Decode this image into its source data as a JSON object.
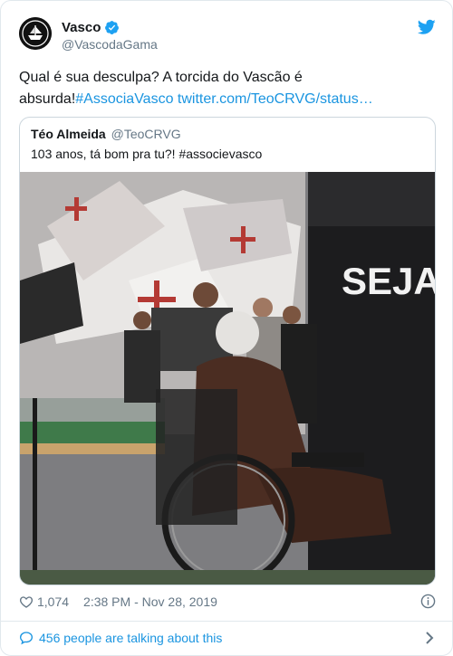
{
  "colors": {
    "link": "#1b95e0",
    "text": "#14171a",
    "secondary": "#657786",
    "border": "#e1e8ed",
    "verified": "#1da1f2"
  },
  "author": {
    "display_name": "Vasco",
    "handle": "@VascodaGama",
    "verified_icon": "verified-badge-icon",
    "avatar_icon": "vasco-crest-logo"
  },
  "brand_icon": "twitter-bird-icon",
  "tweet": {
    "text_part1": "Qual é sua desculpa? A torcida do Vascão é absurda!",
    "hashtag": "#AssociaVasco",
    "link_text": "twitter.com/TeoCRVG/status…"
  },
  "quoted": {
    "name": "Téo Almeida",
    "handle": "@TeoCRVG",
    "text": "103 anos, tá bom pra tu?! #associevasco",
    "photo_sign_text": "SEJA UM"
  },
  "meta": {
    "likes": "1,074",
    "timestamp": "2:38 PM - Nov 28, 2019",
    "like_icon": "heart-icon",
    "info_icon": "info-icon"
  },
  "footer": {
    "talking_text": "456 people are talking about this",
    "icon": "comment-bubble-icon",
    "chevron_icon": "chevron-right-icon"
  }
}
